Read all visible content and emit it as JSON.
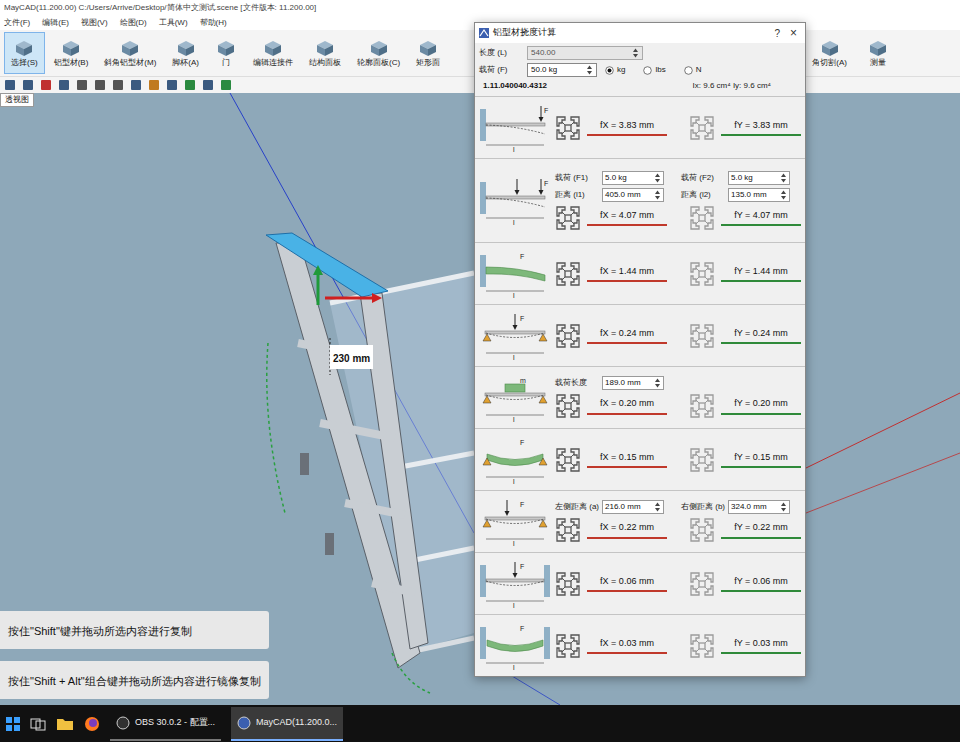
{
  "window": {
    "title": "MayCAD(11.200.00) C:/Users/Arrive/Desktop/简体中文测试.scene [文件版本: 11.200.00]"
  },
  "menu": [
    "文件(F)",
    "编辑(E)",
    "视图(V)",
    "绘图(D)",
    "工具(W)",
    "帮助(H)"
  ],
  "toolbar": {
    "left": [
      {
        "label": "选择(S)",
        "selected": true
      },
      {
        "label": "铝型材(B)",
        "selected": false
      },
      {
        "label": "斜角铝型材(M)",
        "selected": false
      },
      {
        "label": "脚杯(A)",
        "selected": false
      },
      {
        "label": "门",
        "selected": false
      },
      {
        "label": "编辑连接件",
        "selected": false
      },
      {
        "label": "结构面板",
        "selected": false
      },
      {
        "label": "轮廓面板(C)",
        "selected": false
      },
      {
        "label": "矩形面",
        "selected": false
      }
    ],
    "right": [
      {
        "label": "角切割(A)",
        "selected": false
      },
      {
        "label": "测量",
        "selected": false
      }
    ]
  },
  "view_tab": "透视图",
  "viewport": {
    "dimension": "230 mm",
    "hints": [
      "按住\"Shift\"键并拖动所选内容进行复制",
      "按住\"Shift + Alt\"组合键并拖动所选内容进行镜像复制"
    ]
  },
  "dialog": {
    "title": "铝型材挠度计算",
    "help": "?",
    "close": "×",
    "length": {
      "label": "长度 (L)",
      "value": "540.00"
    },
    "load": {
      "label": "载荷 (F)",
      "value": "50.0 kg"
    },
    "units": [
      {
        "label": "kg",
        "selected": true
      },
      {
        "label": "lbs",
        "selected": false
      },
      {
        "label": "N",
        "selected": false
      }
    ],
    "profile_code": "1.11.040040.4312",
    "inertia": "Ix: 9.6 cm⁴  Iy: 9.6 cm⁴",
    "cases": [
      {
        "kind": "cantilever-point",
        "force": "F",
        "span": "l",
        "fields": [],
        "fx": "fX = 3.83 mm",
        "fy": "fY = 3.83 mm"
      },
      {
        "kind": "cantilever-two-point",
        "force": "F",
        "span": "l",
        "fields": [
          {
            "label": "载荷 (F1)",
            "value": "5.0 kg"
          },
          {
            "label": "载荷 (F2)",
            "value": "5.0 kg"
          },
          {
            "label": "距离 (l1)",
            "value": "405.0 mm"
          },
          {
            "label": "距离 (l2)",
            "value": "135.0 mm"
          }
        ],
        "fx": "fX = 4.07 mm",
        "fy": "fY = 4.07 mm"
      },
      {
        "kind": "cantilever-distributed",
        "force": "F",
        "span": "l",
        "fields": [],
        "fx": "fX = 1.44 mm",
        "fy": "fY = 1.44 mm"
      },
      {
        "kind": "simple-point",
        "force": "F",
        "span": "l",
        "fields": [],
        "fx": "fX = 0.24 mm",
        "fy": "fY = 0.24 mm"
      },
      {
        "kind": "simple-partial",
        "force": "m",
        "span": "l",
        "fields": [
          {
            "label": "载荷长度",
            "value": "189.0 mm"
          }
        ],
        "fx": "fX = 0.20 mm",
        "fy": "fY = 0.20 mm"
      },
      {
        "kind": "simple-distributed",
        "force": "F",
        "span": "l",
        "fields": [],
        "fx": "fX = 0.15 mm",
        "fy": "fY = 0.15 mm"
      },
      {
        "kind": "simple-offset",
        "force": "F",
        "span": "l",
        "fields": [
          {
            "label": "左侧距离 (a)",
            "value": "216.0 mm"
          },
          {
            "label": "右侧距离 (b)",
            "value": "324.0 mm"
          }
        ],
        "fx": "fX = 0.22 mm",
        "fy": "fY = 0.22 mm"
      },
      {
        "kind": "fixed-point",
        "force": "F",
        "span": "l",
        "fields": [],
        "fx": "fX = 0.06 mm",
        "fy": "fY = 0.06 mm"
      },
      {
        "kind": "fixed-distributed",
        "force": "F",
        "span": "l",
        "fields": [],
        "fx": "fX = 0.03 mm",
        "fy": "fY = 0.03 mm"
      }
    ]
  },
  "taskbar": {
    "items": [
      {
        "label": "OBS 30.0.2 - 配置...",
        "active": false
      },
      {
        "label": "MayCAD(11.200.0...",
        "active": true
      }
    ]
  }
}
